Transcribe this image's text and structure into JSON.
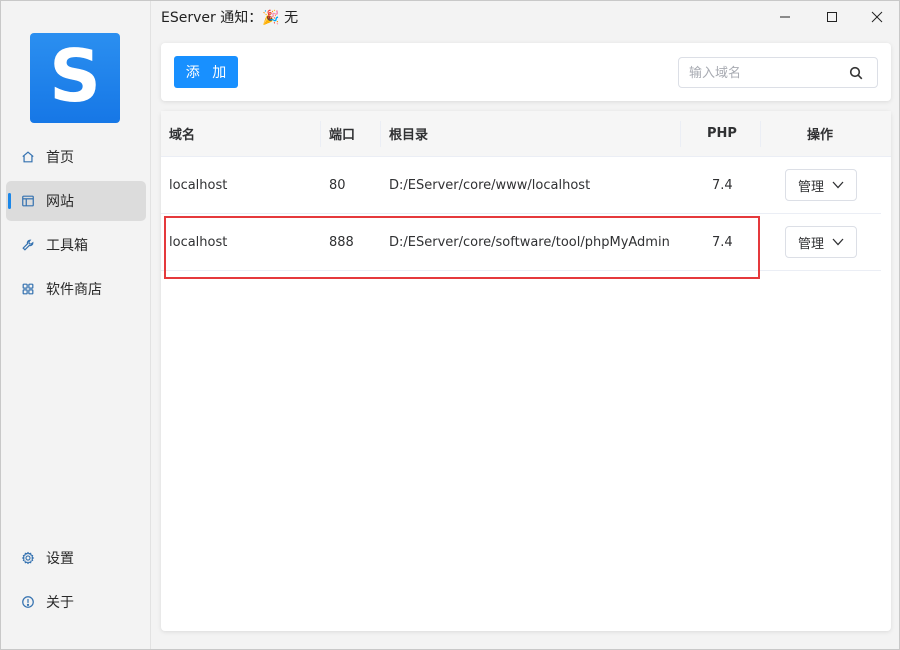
{
  "app": {
    "title": "EServer 通知：🎉 无",
    "logo_letter": "S",
    "accent_color": "#1890ff"
  },
  "sidebar": {
    "items": [
      {
        "label": "首页",
        "icon": "home-icon"
      },
      {
        "label": "网站",
        "icon": "website-icon"
      },
      {
        "label": "工具箱",
        "icon": "wrench-icon"
      },
      {
        "label": "软件商店",
        "icon": "apps-icon"
      }
    ],
    "bottom_items": [
      {
        "label": "设置",
        "icon": "gear-icon"
      },
      {
        "label": "关于",
        "icon": "info-icon"
      }
    ],
    "active_index": 1
  },
  "toolbar": {
    "add_label": "添 加",
    "search_placeholder": "输入域名"
  },
  "table": {
    "columns": [
      "域名",
      "端口",
      "根目录",
      "PHP",
      "操作"
    ],
    "rows": [
      {
        "domain": "localhost",
        "port": "80",
        "root": "D:/EServer/core/www/localhost",
        "php": "7.4",
        "action": "管理"
      },
      {
        "domain": "localhost",
        "port": "888",
        "root": "D:/EServer/core/software/tool/phpMyAdmin",
        "php": "7.4",
        "action": "管理"
      }
    ],
    "highlighted_row": 1,
    "highlight_color": "#e5393c"
  }
}
